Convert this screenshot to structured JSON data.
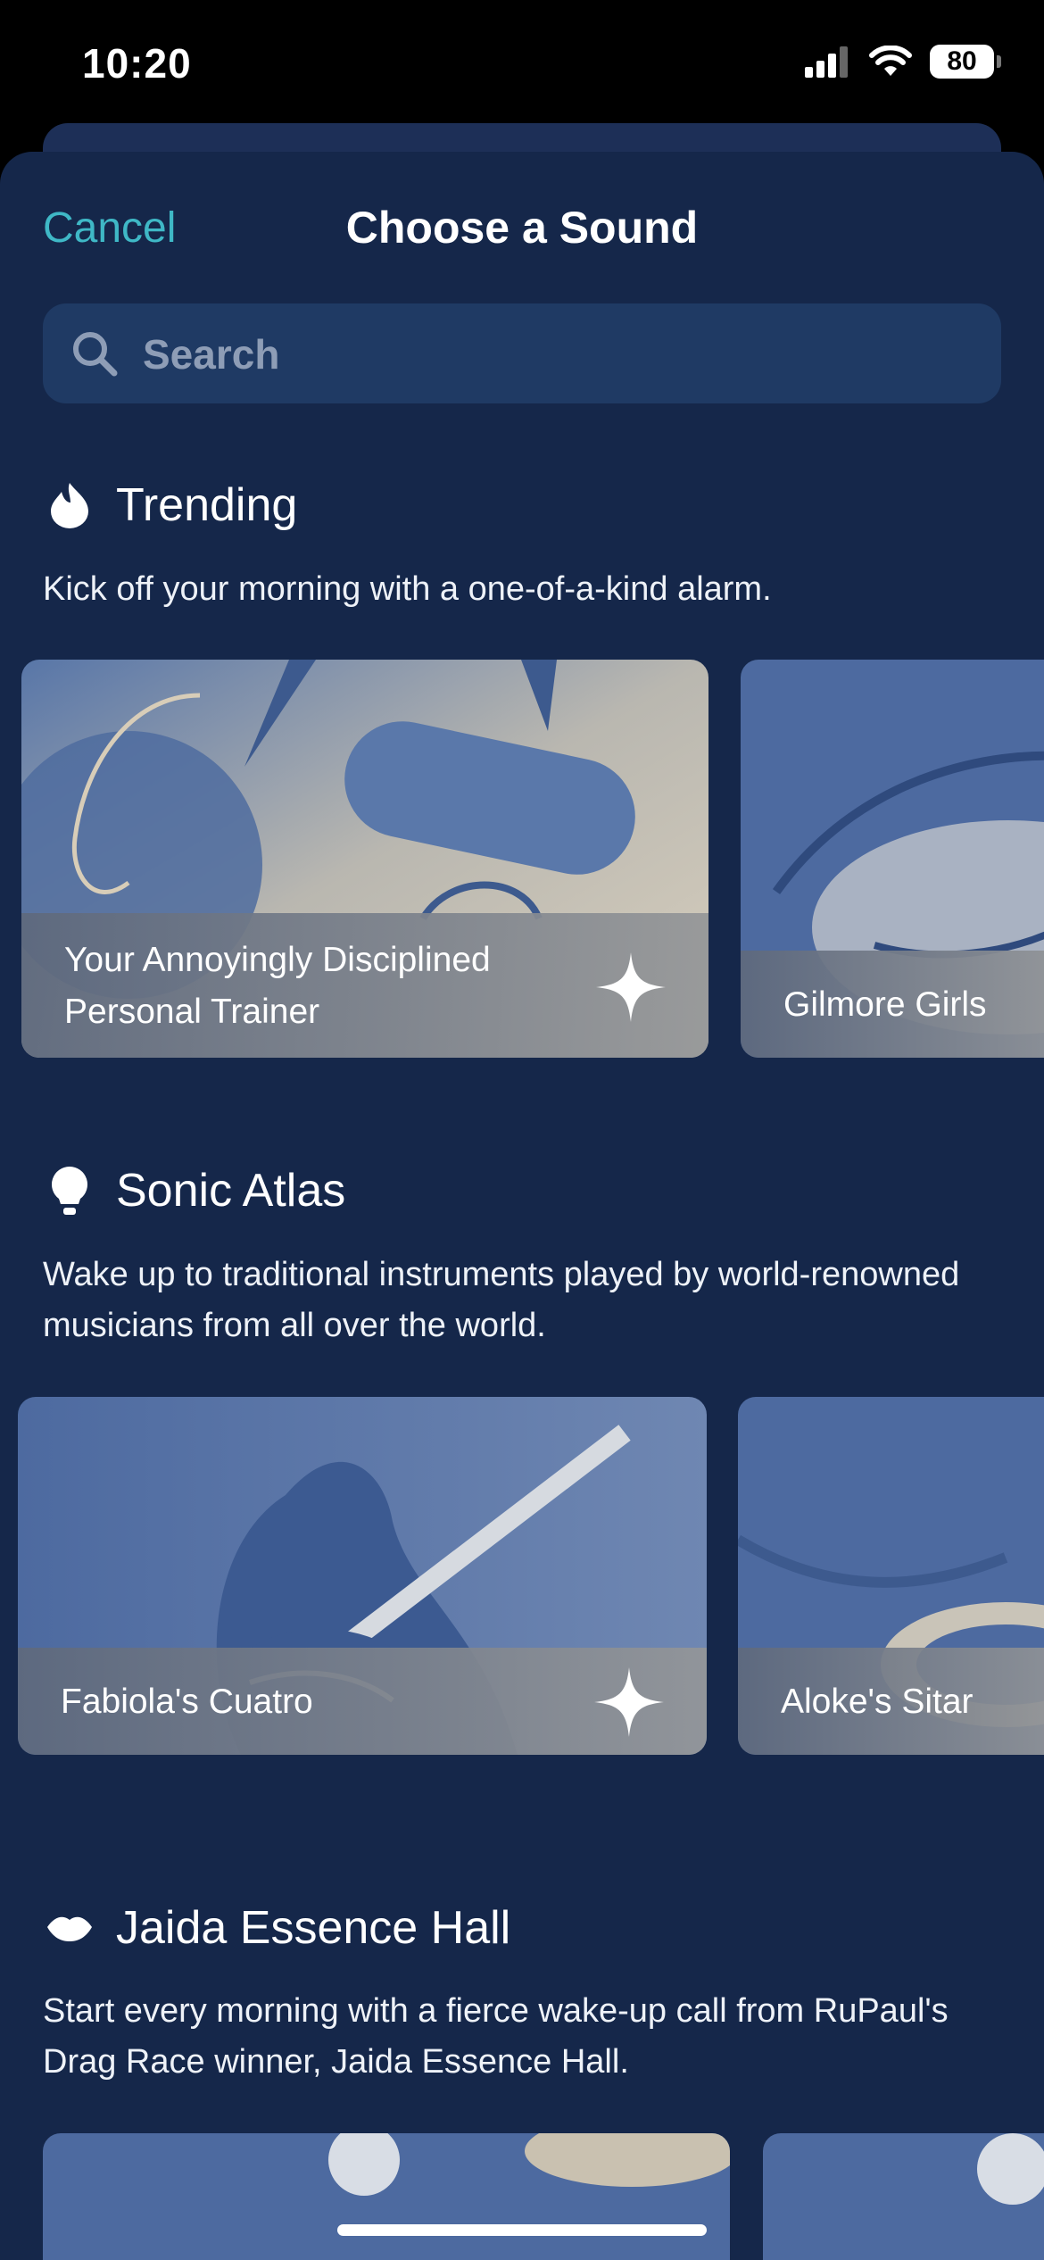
{
  "status_bar": {
    "time": "10:20",
    "battery": "80"
  },
  "header": {
    "cancel_label": "Cancel",
    "title": "Choose a Sound"
  },
  "search": {
    "placeholder": "Search"
  },
  "sections": [
    {
      "title": "Trending",
      "icon": "flame-icon",
      "description": "Kick off your morning with a one-of-a-kind alarm.",
      "cards": [
        {
          "name": "Your Annoyingly Disciplined Personal Trainer",
          "badge": "sparkle-icon"
        },
        {
          "name": "Gilmore Girls"
        }
      ]
    },
    {
      "title": "Sonic Atlas",
      "icon": "lightbulb-icon",
      "description": "Wake up to traditional instruments played by world-renowned musicians from all over the world.",
      "cards": [
        {
          "name": "Fabiola's Cuatro",
          "badge": "sparkle-icon"
        },
        {
          "name": "Aloke's Sitar"
        }
      ]
    },
    {
      "title": "Jaida Essence Hall",
      "icon": "lips-icon",
      "description": "Start every morning with a fierce wake-up call from RuPaul's Drag Race winner, Jaida Essence Hall."
    }
  ],
  "colors": {
    "background": "#15274a",
    "accent": "#3fb8c6",
    "search_bg": "#1f3a64"
  }
}
